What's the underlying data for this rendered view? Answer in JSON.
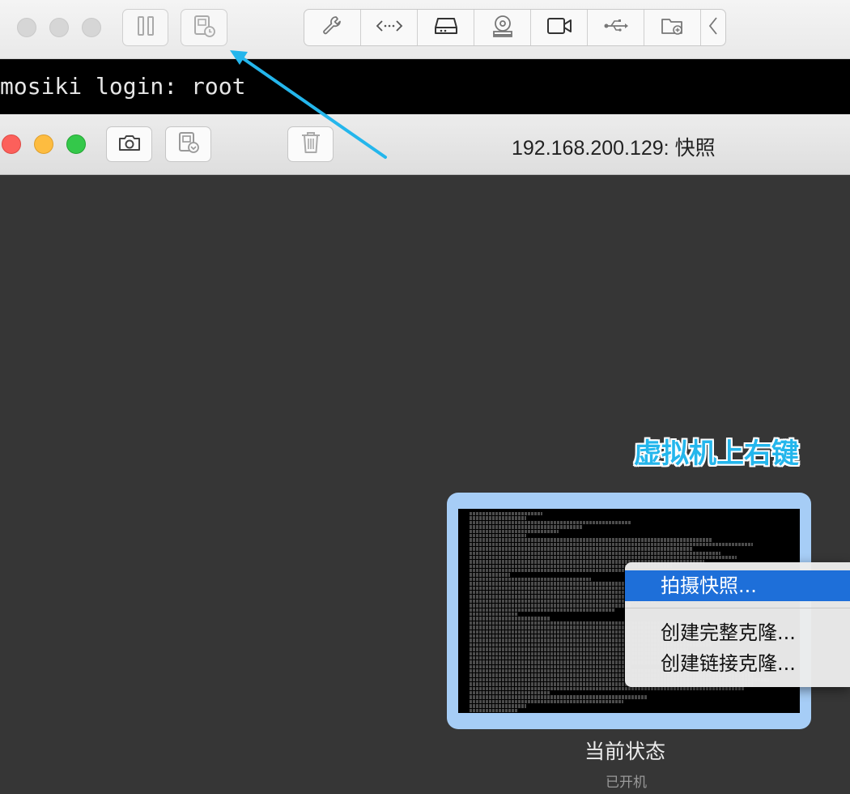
{
  "vm_toolbar": {
    "traffic_lights": [
      "inactive",
      "inactive",
      "inactive"
    ],
    "buttons": [
      {
        "name": "pause-button",
        "icon": "pause-icon"
      },
      {
        "name": "snapshot-manager-button",
        "icon": "snapshot-manager-icon"
      }
    ],
    "device_icons": [
      "wrench-icon",
      "network-icon",
      "hard-disk-icon",
      "optical-drive-icon",
      "camera-icon",
      "usb-icon",
      "shared-folder-icon",
      "chevron-left-icon"
    ]
  },
  "console": {
    "text": "mosiki login: root"
  },
  "snapshot_window": {
    "title": "192.168.200.129: 快照",
    "buttons": [
      "camera-icon",
      "revert-snapshot-icon",
      "trash-icon"
    ]
  },
  "annotation": {
    "text": "虚拟机上右键",
    "color": "#24b6ec"
  },
  "context_menu": {
    "items": [
      {
        "label": "拍摄快照...",
        "selected": true
      },
      {
        "label": "创建完整克隆...",
        "selected": false
      },
      {
        "label": "创建链接克隆...",
        "selected": false
      }
    ]
  },
  "current_state": {
    "title": "当前状态",
    "subtitle": "已开机"
  },
  "colors": {
    "accent": "#1e6fd9",
    "selection_frame": "#a6cdf6",
    "background": "#363636",
    "arrow": "#24b6ec"
  }
}
